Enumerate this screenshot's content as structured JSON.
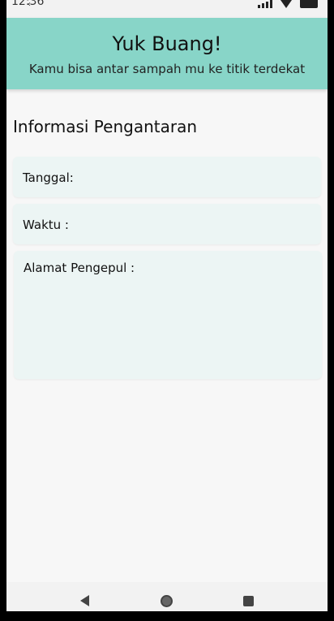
{
  "status_bar": {
    "time": "12:36",
    "icons": [
      "signal-icon",
      "wifi-icon",
      "battery-icon"
    ]
  },
  "header": {
    "title": "Yuk Buang!",
    "subtitle": "Kamu bisa antar sampah mu ke titik terdekat",
    "background": "#88d5c8"
  },
  "section": {
    "title": "Informasi Pengantaran"
  },
  "fields": {
    "tanggal_label": "Tanggal:",
    "waktu_label": "Waktu :",
    "alamat_label": "Alamat Pengepul :",
    "card_background": "#ecf5f4"
  },
  "nav_bar": {
    "buttons": [
      "back-icon",
      "home-icon",
      "recents-icon"
    ]
  }
}
